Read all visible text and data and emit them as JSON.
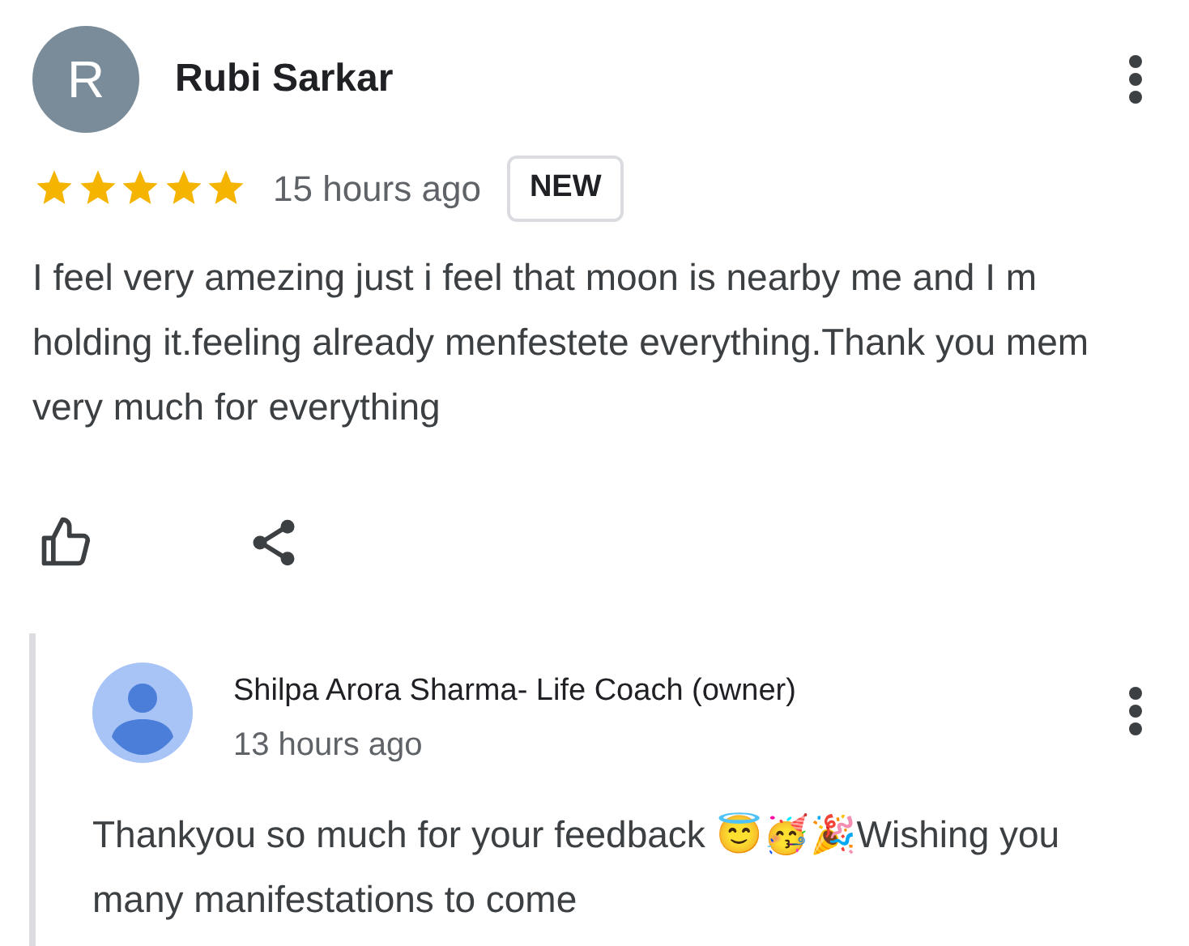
{
  "review": {
    "avatar_letter": "R",
    "author": "Rubi Sarkar",
    "stars": 5,
    "time": "15 hours ago",
    "badge": "NEW",
    "text": "I feel very amezing just i feel that moon is nearby me and I m holding it.feeling already menfestete everything.Thank you mem very much for everything"
  },
  "reply": {
    "author": "Shilpa Arora Sharma- Life Coach (owner)",
    "time": "13 hours ago",
    "text": "Thankyou so much for your feedback 😇🥳🎉Wishing you many manifestations to come"
  }
}
